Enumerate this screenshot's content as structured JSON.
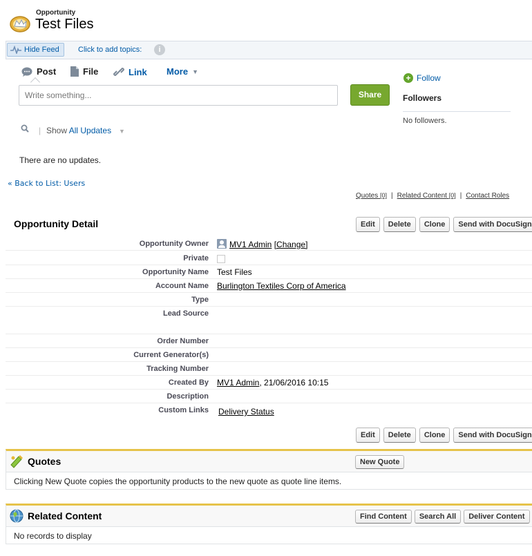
{
  "header": {
    "object_label": "Opportunity",
    "record_name": "Test Files"
  },
  "feed_bar": {
    "hide_feed_label": "Hide Feed",
    "topics_label": "Click to add topics:"
  },
  "publisher": {
    "tabs": [
      "Post",
      "File",
      "Link"
    ],
    "more_label": "More",
    "placeholder": "Write something...",
    "share_label": "Share"
  },
  "follow": {
    "follow_label": "Follow",
    "followers_heading": "Followers",
    "no_followers": "No followers."
  },
  "feed_filter": {
    "show_label": "Show",
    "filter_value": "All Updates",
    "empty_message": "There are no updates."
  },
  "back_link": "« Back to List: Users",
  "related_links": [
    {
      "label": "Quotes",
      "count": "[0]"
    },
    {
      "label": "Related Content",
      "count": "[0]"
    },
    {
      "label": "Contact Roles",
      "count": ""
    }
  ],
  "detail": {
    "title": "Opportunity Detail",
    "buttons": [
      "Edit",
      "Delete",
      "Clone",
      "Send with DocuSign"
    ],
    "fields": {
      "owner": {
        "label": "Opportunity Owner",
        "value": "MV1 Admin",
        "change_label": "[Change]"
      },
      "private": {
        "label": "Private",
        "checked": false
      },
      "name": {
        "label": "Opportunity Name",
        "value": "Test Files"
      },
      "account": {
        "label": "Account Name",
        "value": "Burlington Textiles Corp of America"
      },
      "type": {
        "label": "Type",
        "value": ""
      },
      "lead_source": {
        "label": "Lead Source",
        "value": ""
      },
      "order_number": {
        "label": "Order Number",
        "value": ""
      },
      "generators": {
        "label": "Current Generator(s)",
        "value": ""
      },
      "tracking": {
        "label": "Tracking Number",
        "value": ""
      },
      "created_by": {
        "label": "Created By",
        "user": "MV1 Admin",
        "date": ", 21/06/2016 10:15"
      },
      "description": {
        "label": "Description",
        "value": ""
      },
      "custom_links": {
        "label": "Custom Links",
        "value": "Delivery Status"
      }
    }
  },
  "quotes": {
    "title": "Quotes",
    "new_button": "New Quote",
    "message": "Clicking New Quote copies the opportunity products to the new quote as quote line items."
  },
  "related_content": {
    "title": "Related Content",
    "buttons": [
      "Find Content",
      "Search All",
      "Deliver Content"
    ],
    "message": "No records to display"
  },
  "colors": {
    "link": "#015ba7",
    "share_button": "#77a82f",
    "related_list_accent": "#e6c34a"
  }
}
